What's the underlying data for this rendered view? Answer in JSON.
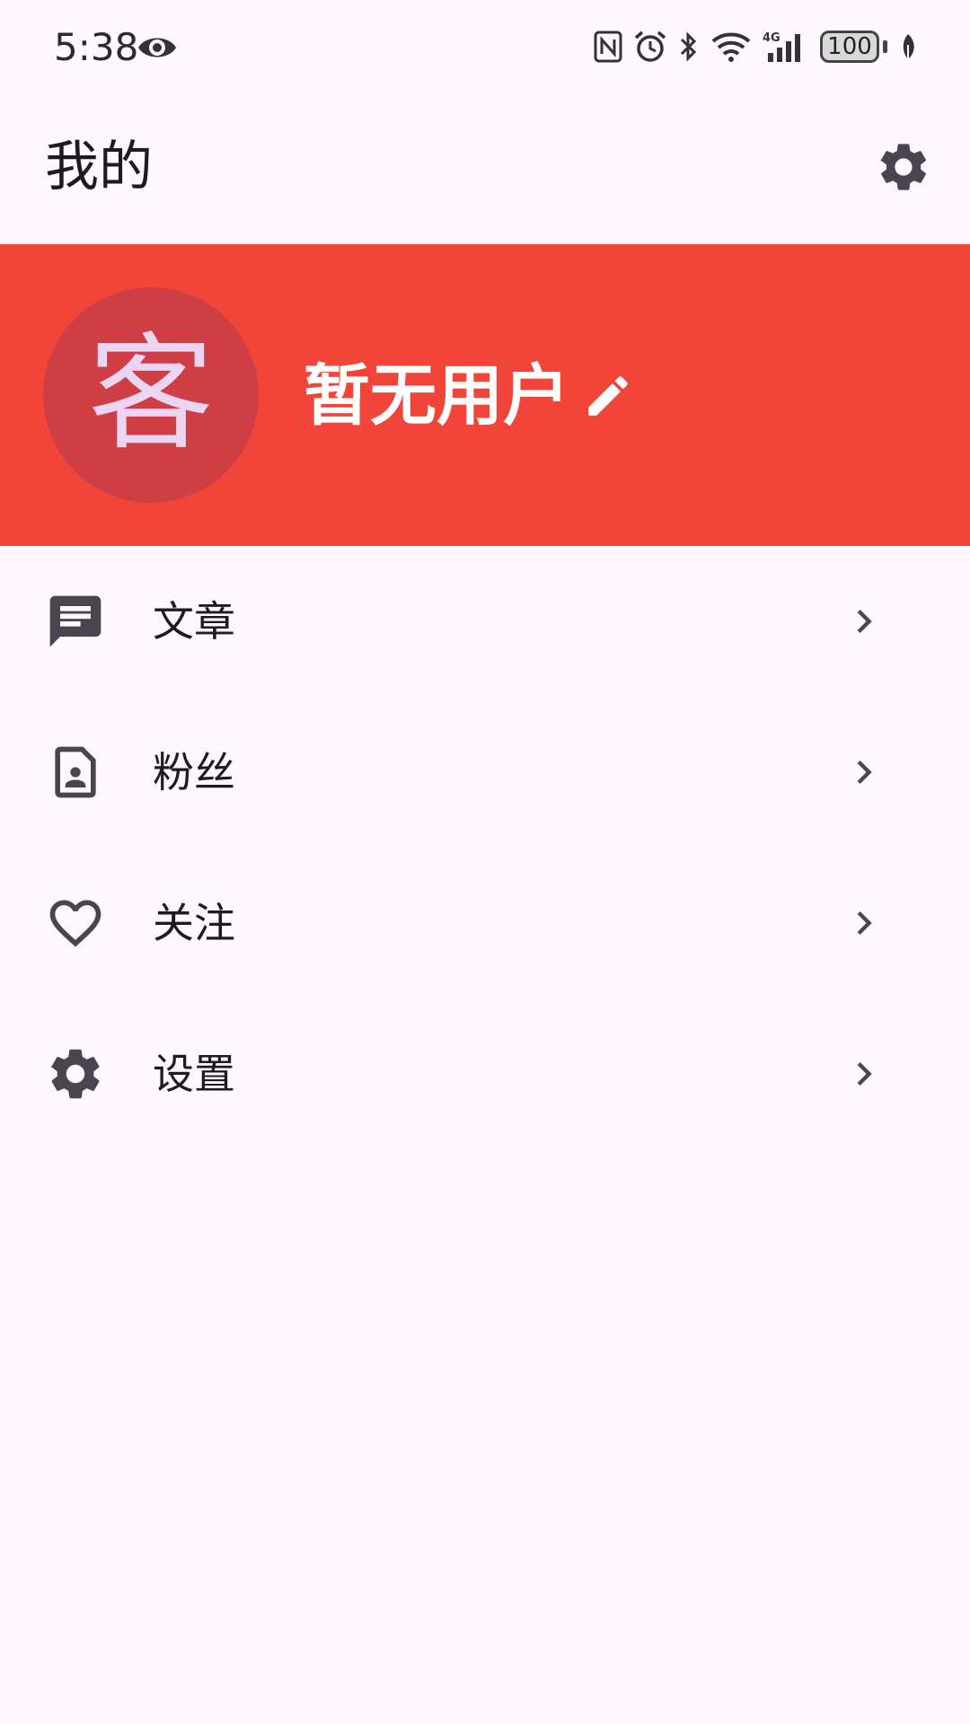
{
  "status_bar": {
    "time": "5:38",
    "network": "4G",
    "battery": "100"
  },
  "app_bar": {
    "title": "我的"
  },
  "profile": {
    "avatar_char": "客",
    "username": "暂无用户"
  },
  "menu": {
    "items": [
      {
        "label": "文章",
        "icon": "article-icon"
      },
      {
        "label": "粉丝",
        "icon": "contact-page-icon"
      },
      {
        "label": "关注",
        "icon": "heart-icon"
      },
      {
        "label": "设置",
        "icon": "gear-icon"
      }
    ]
  },
  "colors": {
    "background": "#FEF7FF",
    "banner": "#F2453A",
    "avatar_bg": "#D03E45",
    "avatar_text": "#EBD5F2",
    "icon": "#49454F"
  }
}
